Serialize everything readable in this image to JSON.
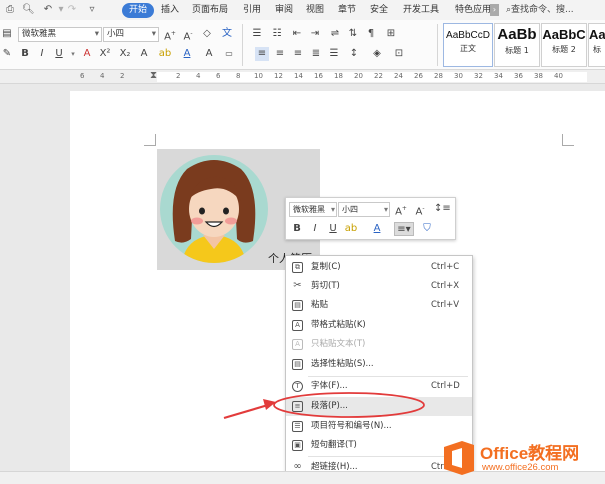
{
  "tabs": {
    "items": [
      "开始",
      "插入",
      "页面布局",
      "引用",
      "审阅",
      "视图",
      "章节",
      "安全",
      "开发工具",
      "特色应用"
    ],
    "search": "查找命令、搜..."
  },
  "ribbon": {
    "font_name": "微软雅黑",
    "font_size": "小四",
    "styles": [
      {
        "sample": "AaBbCcD",
        "label": "正文"
      },
      {
        "sample": "AaBb",
        "label": "标题 1"
      },
      {
        "sample": "AaBbC",
        "label": "标题 2"
      },
      {
        "sample": "Aa",
        "label": "标"
      }
    ]
  },
  "ruler": {
    "numbers": [
      "6",
      "4",
      "2",
      "2",
      "4",
      "6",
      "8",
      "10",
      "12",
      "14",
      "16",
      "18",
      "20",
      "22",
      "24",
      "26",
      "28",
      "30",
      "32",
      "34",
      "36",
      "38",
      "40"
    ]
  },
  "document": {
    "caption": "个人简历"
  },
  "mini_toolbar": {
    "font_name": "微软雅黑",
    "font_size": "小四"
  },
  "context_menu": {
    "items": [
      {
        "label": "复制(C)",
        "shortcut": "Ctrl+C",
        "icon": "copy-icon",
        "glyph": "⧉",
        "enabled": true
      },
      {
        "label": "剪切(T)",
        "shortcut": "Ctrl+X",
        "icon": "scissors-icon",
        "glyph": "✂",
        "enabled": true
      },
      {
        "label": "粘贴",
        "shortcut": "Ctrl+V",
        "icon": "paste-icon",
        "glyph": "▤",
        "enabled": true
      },
      {
        "label": "带格式粘贴(K)",
        "shortcut": "",
        "icon": "paste-format-icon",
        "glyph": "A",
        "enabled": true
      },
      {
        "label": "只粘贴文本(T)",
        "shortcut": "",
        "icon": "paste-text-icon",
        "glyph": "A",
        "enabled": false
      },
      {
        "label": "选择性粘贴(S)...",
        "shortcut": "",
        "icon": "paste-special-icon",
        "glyph": "▤",
        "enabled": true
      },
      {
        "label": "字体(F)...",
        "shortcut": "Ctrl+D",
        "icon": "font-icon",
        "glyph": "T",
        "enabled": true
      },
      {
        "label": "段落(P)...",
        "shortcut": "",
        "icon": "paragraph-icon",
        "glyph": "≡",
        "enabled": true
      },
      {
        "label": "项目符号和编号(N)...",
        "shortcut": "",
        "icon": "bullets-icon",
        "glyph": "☰",
        "enabled": true
      },
      {
        "label": "短句翻译(T)",
        "shortcut": "",
        "icon": "translate-icon",
        "glyph": "▣",
        "enabled": true
      },
      {
        "label": "超链接(H)...",
        "shortcut": "Ctrl",
        "icon": "hyperlink-icon",
        "glyph": "∞",
        "enabled": true
      }
    ]
  },
  "watermark": {
    "brand": "Office教程网",
    "url": "www.office26.com"
  },
  "colors": {
    "accent": "#3b7bd6",
    "arrow": "#e23b3b",
    "watermark_orange": "#f36f21"
  }
}
